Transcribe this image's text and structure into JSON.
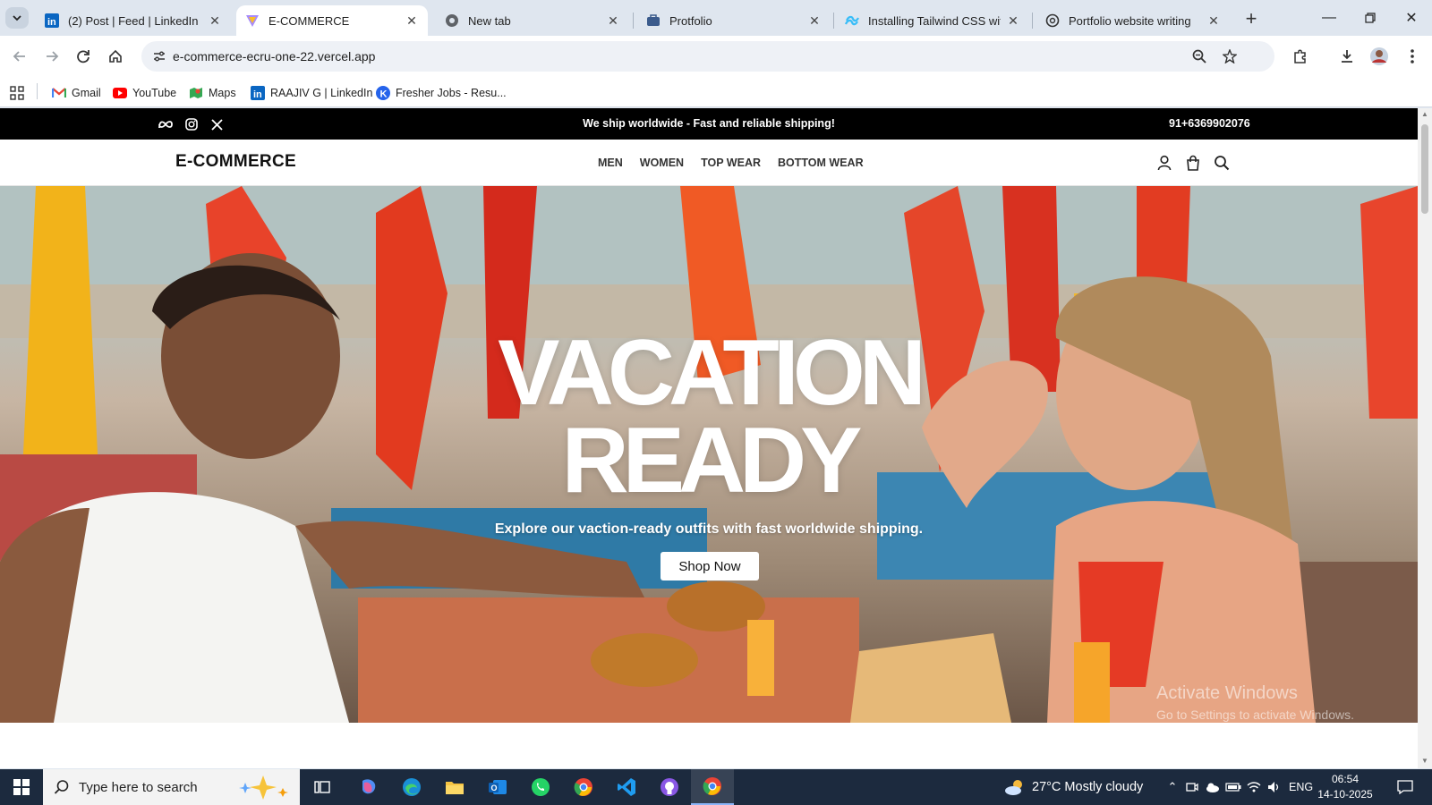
{
  "browser": {
    "tabs": [
      {
        "title": "(2) Post | Feed | LinkedIn",
        "icon": "linkedin-icon"
      },
      {
        "title": "E-COMMERCE",
        "icon": "vercel-icon",
        "active": true
      },
      {
        "title": "New tab",
        "icon": "chrome-icon"
      },
      {
        "title": "Protfolio",
        "icon": "briefcase-icon"
      },
      {
        "title": "Installing Tailwind CSS with V",
        "icon": "tailwind-icon"
      },
      {
        "title": "Portfolio website writing",
        "icon": "openai-icon"
      }
    ],
    "url": "e-commerce-ecru-one-22.vercel.app",
    "bookmarks": [
      {
        "label": "Gmail",
        "icon": "gmail-icon"
      },
      {
        "label": "YouTube",
        "icon": "youtube-icon"
      },
      {
        "label": "Maps",
        "icon": "maps-icon"
      },
      {
        "label": "RAAJIV G | LinkedIn",
        "icon": "linkedin-icon"
      },
      {
        "label": "Fresher Jobs - Resu...",
        "icon": "k-icon"
      }
    ]
  },
  "site": {
    "topbar": {
      "promo": "We ship worldwide - Fast and reliable shipping!",
      "phone": "91+6369902076",
      "social": [
        "meta-icon",
        "instagram-icon",
        "x-icon"
      ]
    },
    "brand": "E-COMMERCE",
    "nav": [
      "MEN",
      "WOMEN",
      "TOP WEAR",
      "BOTTOM WEAR"
    ],
    "hero": {
      "title_line1": "VACATION",
      "title_line2": "READY",
      "subtitle": "Explore our vaction-ready outfits with fast worldwide shipping.",
      "cta": "Shop Now"
    },
    "watermark": {
      "line1": "Activate Windows",
      "line2": "Go to Settings to activate Windows."
    }
  },
  "taskbar": {
    "search_placeholder": "Type here to search",
    "weather": "27°C  Mostly cloudy",
    "language": "ENG",
    "time": "06:54",
    "date": "14-10-2025"
  },
  "colors": {
    "topbar_bg": "#000000",
    "accent": "#1a73e8",
    "taskbar_bg": "#1c2a3e"
  }
}
